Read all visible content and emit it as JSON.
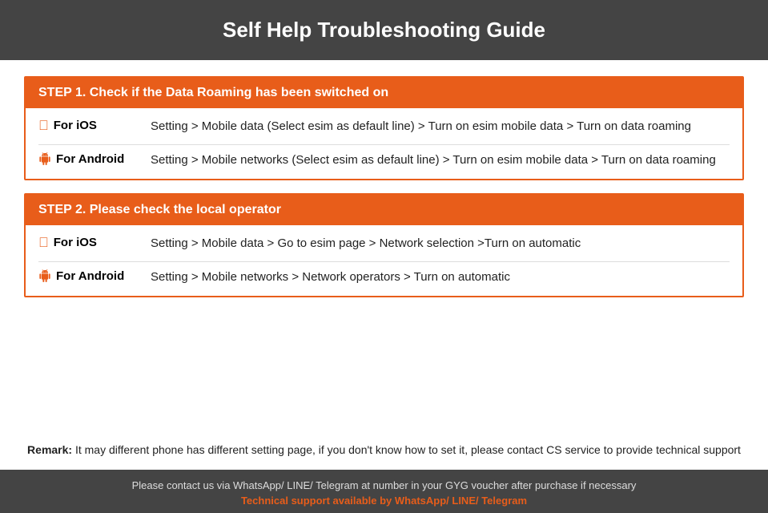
{
  "header": {
    "title": "Self Help Troubleshooting Guide"
  },
  "step1": {
    "heading": "STEP 1.  Check if the Data Roaming has been switched on",
    "ios_label": "For iOS",
    "ios_text": "Setting > Mobile data (Select esim as default line) > Turn on esim mobile data > Turn on data roaming",
    "android_label": "For Android",
    "android_text": "Setting > Mobile networks (Select esim as default line) > Turn on esim mobile data > Turn on data roaming"
  },
  "step2": {
    "heading": "STEP 2.  Please check the local operator",
    "ios_label": "For iOS",
    "ios_text": "Setting > Mobile data > Go to esim page > Network selection >Turn on automatic",
    "android_label": "For Android",
    "android_text": "Setting > Mobile networks > Network operators > Turn on automatic"
  },
  "remark": {
    "label": "Remark:",
    "text": " It may different phone has different setting page, if you don't know how to set it,  please contact CS service to provide technical support"
  },
  "footer": {
    "main_text": "Please contact us via WhatsApp/ LINE/ Telegram at number in your GYG voucher after purchase if necessary",
    "support_text": "Technical support available by WhatsApp/ LINE/ Telegram"
  },
  "colors": {
    "accent": "#e85d1a",
    "header_bg": "#444444",
    "footer_bg": "#444444"
  }
}
